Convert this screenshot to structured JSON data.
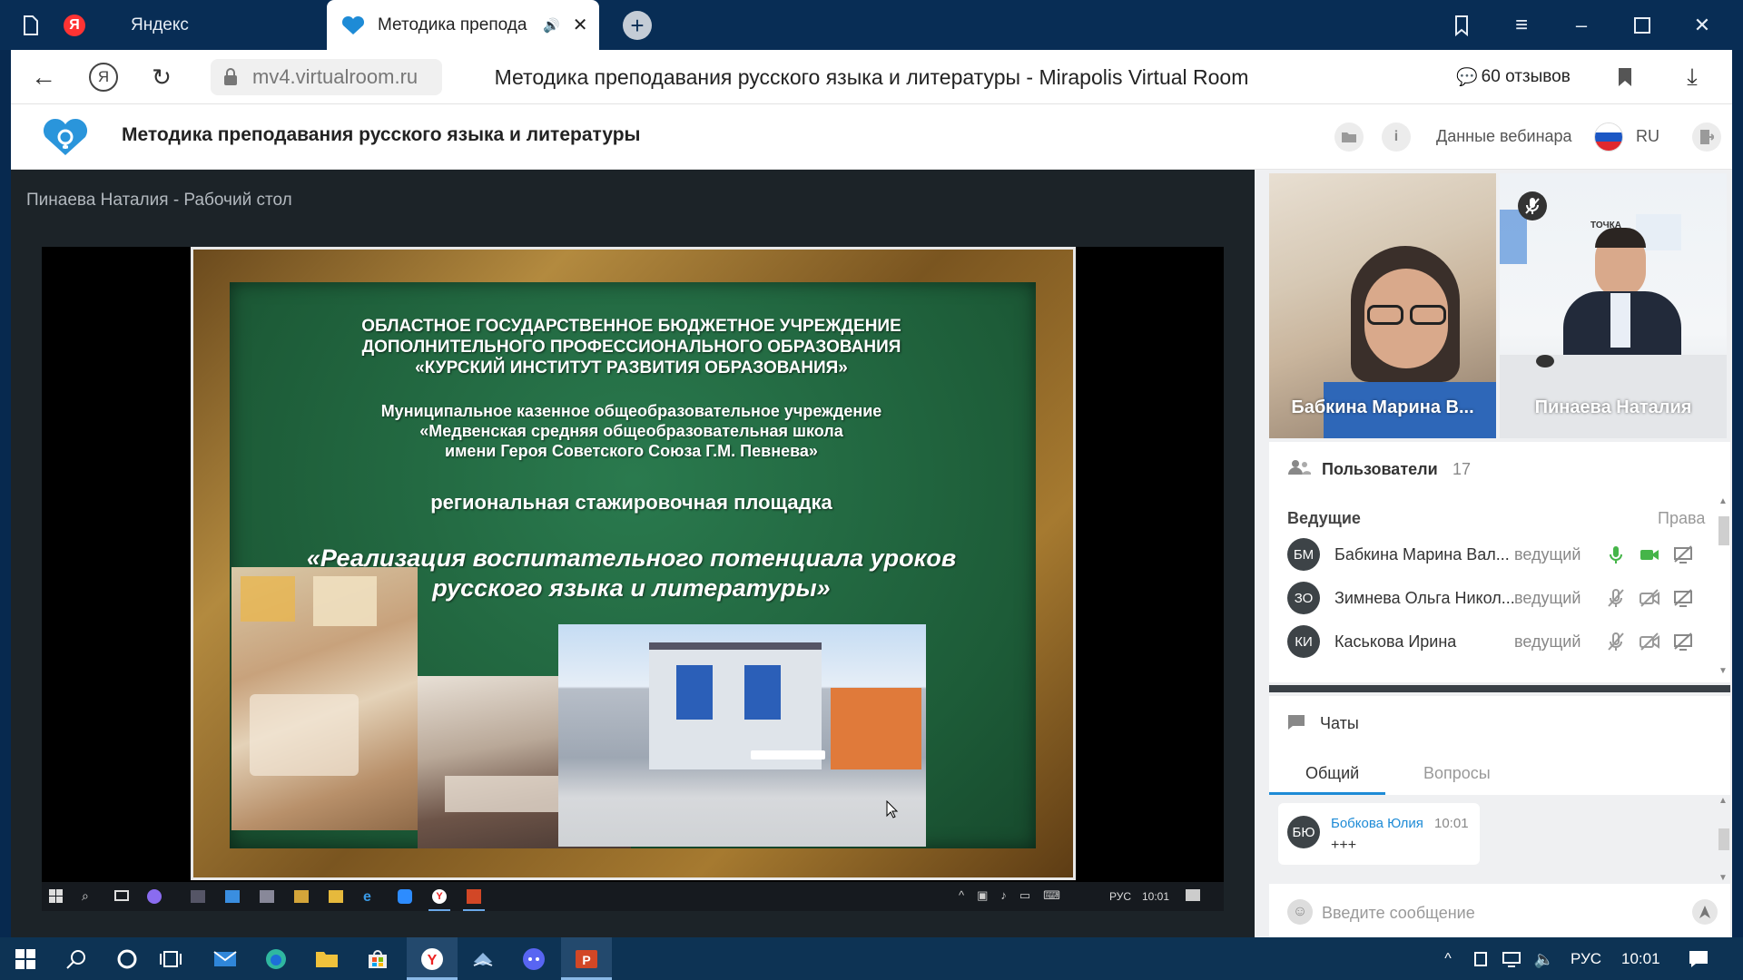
{
  "browser": {
    "tabs": [
      {
        "label": "Яндекс",
        "icon": "yandex-icon"
      },
      {
        "label": "Методика препода",
        "icon": "mirapolis-icon"
      }
    ],
    "url": "mv4.virtualroom.ru",
    "page_title": "Методика преподавания русского языка и литературы - Mirapolis Virtual Room",
    "reviews": "60 отзывов"
  },
  "app": {
    "title": "Методика преподавания русского языка и литературы",
    "webinar_data": "Данные вебинара",
    "language": "RU"
  },
  "screen_share": {
    "title": "Пинаева Наталия - Рабочий стол",
    "slide_lines": [
      "ОБЛАСТНОЕ ГОСУДАРСТВЕННОЕ БЮДЖЕТНОЕ УЧРЕЖДЕНИЕ",
      "ДОПОЛНИТЕЛЬНОГО ПРОФЕССИОНАЛЬНОГО ОБРАЗОВАНИЯ",
      "«КУРСКИЙ ИНСТИТУТ РАЗВИТИЯ ОБРАЗОВАНИЯ»",
      "Муниципальное казенное общеобразовательное учреждение",
      "«Медвенская средняя общеобразовательная школа",
      "имени Героя Советского Союза Г.М. Певнева»",
      "региональная стажировочная площадка",
      "«Реализация воспитательного потенциала уроков",
      "русского языка и литературы»"
    ],
    "inner_taskbar": {
      "lang": "РУС",
      "time": "10:01"
    }
  },
  "video": [
    {
      "name": "Бабкина Марина В..."
    },
    {
      "name": "Пинаева Наталия",
      "sign": "ТОЧКА"
    }
  ],
  "users_panel": {
    "title": "Пользователи",
    "count": "17",
    "section": "Ведущие",
    "rights": "Права",
    "users": [
      {
        "initials": "БМ",
        "name": "Бабкина Марина Вал...",
        "role": "ведущий",
        "mic": true,
        "cam": true
      },
      {
        "initials": "ЗО",
        "name": "Зимнева Ольга Никол...",
        "role": "ведущий",
        "mic": false,
        "cam": false
      },
      {
        "initials": "КИ",
        "name": "Каськова Ирина",
        "role": "ведущий",
        "mic": false,
        "cam": false
      }
    ]
  },
  "chats": {
    "title": "Чаты",
    "tabs": [
      "Общий",
      "Вопросы"
    ],
    "messages": [
      {
        "initials": "БЮ",
        "author": "Бобкова Юлия",
        "time": "10:01",
        "text": "+++"
      }
    ],
    "input_placeholder": "Введите сообщение"
  },
  "os_taskbar": {
    "lang": "РУС",
    "time": "10:01"
  },
  "colors": {
    "accent": "#1e8bd6",
    "green_board": "#236b43",
    "frame": "#8a5a1c"
  }
}
